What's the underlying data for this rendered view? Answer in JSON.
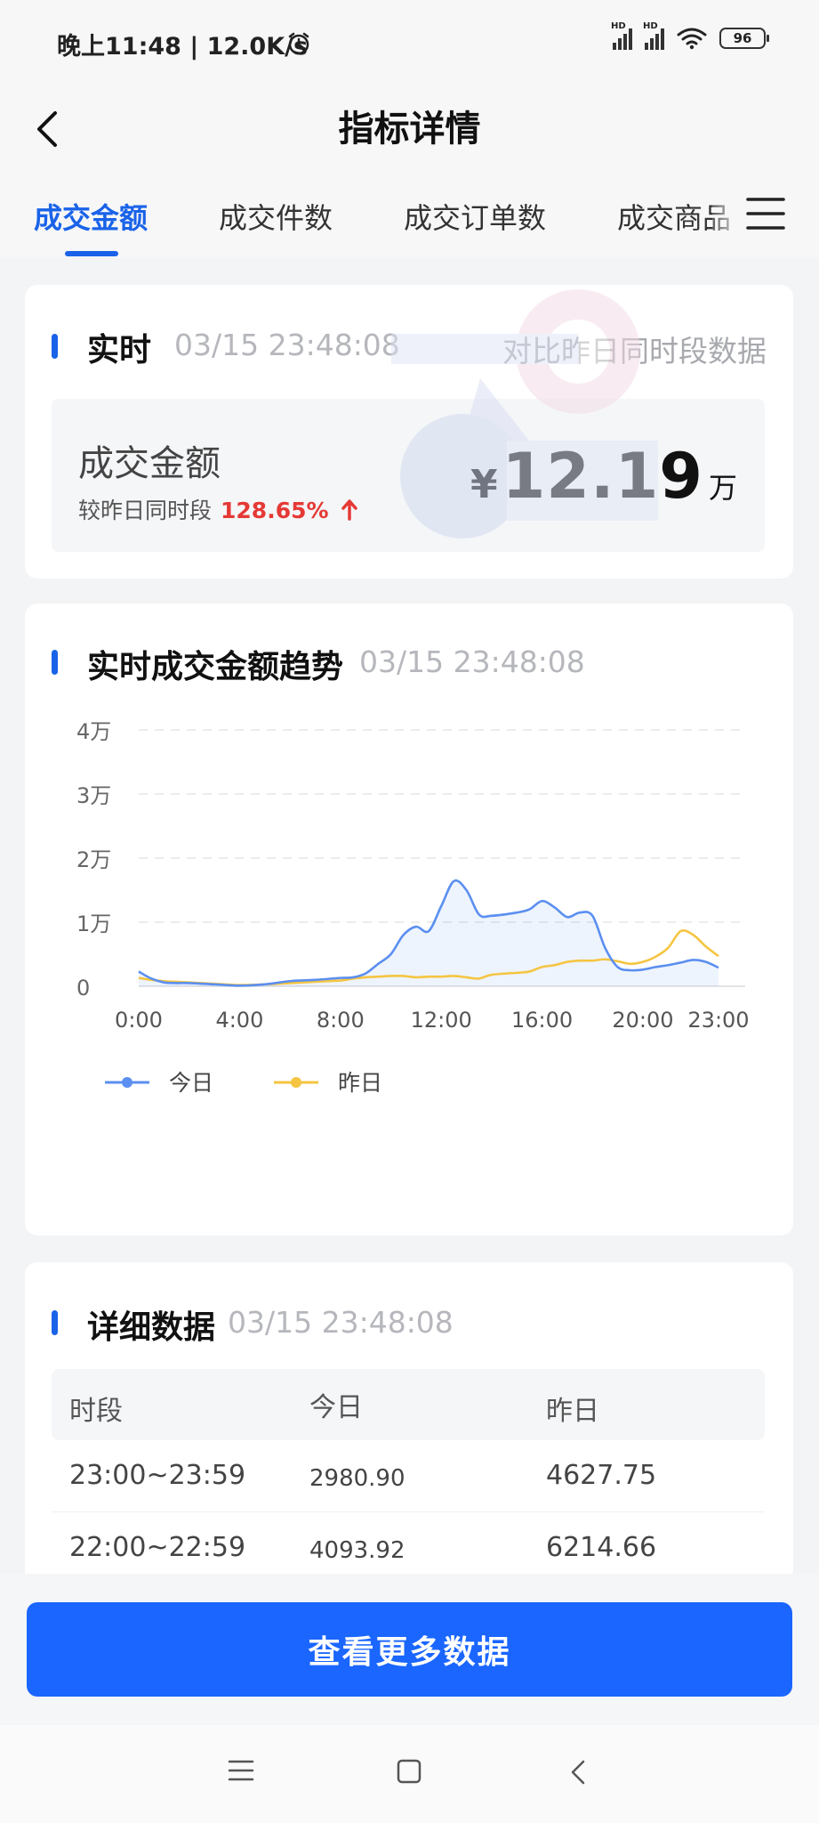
{
  "status_bar": {
    "time": "晚上11:48 | 12.0K/s",
    "signal1": "HD",
    "signal2": "HD",
    "battery": "96",
    "icons": [
      "alarm-icon",
      "signal-icon",
      "signal-icon",
      "wifi-icon",
      "battery-icon"
    ]
  },
  "nav": {
    "title": "指标详情",
    "back_icon": "chevron-left-icon",
    "menu_icon": "menu-icon"
  },
  "tabs": [
    "成交金额",
    "成交件数",
    "成交订单数",
    "成交商品"
  ],
  "realtime": {
    "title": "实时",
    "timestamp": "03/15 23:48:08",
    "compare_link": "对比昨日同时段数据",
    "metric_label": "成交金额",
    "metric_sub": "较昨日同时段",
    "metric_pct": "128.65%",
    "metric_currency": "¥",
    "metric_value": "12.19",
    "metric_unit": "万"
  },
  "trend": {
    "title": "实时成交金额趋势",
    "timestamp": "03/15 23:48:08"
  },
  "chart_data": {
    "type": "area",
    "y_tick_labels": [
      "4万",
      "3万",
      "2万",
      "1万",
      "0"
    ],
    "x_tick_labels": [
      "0:00",
      "4:00",
      "8:00",
      "12:00",
      "16:00",
      "20:00",
      "23:00"
    ],
    "ylim": [
      0,
      40000
    ],
    "grid": true,
    "legend_position": "bottom-left",
    "x": [
      0,
      0.5,
      1,
      1.5,
      2,
      3,
      4,
      5,
      6,
      7,
      8,
      8.5,
      9,
      9.5,
      10,
      10.5,
      11,
      11.5,
      12,
      12.5,
      13,
      13.5,
      14,
      15,
      15.5,
      16,
      16.5,
      17,
      17.5,
      18,
      18.5,
      19,
      19.5,
      20,
      20.5,
      21,
      21.5,
      22,
      22.5,
      23
    ],
    "series": [
      {
        "name": "今日",
        "color": "#5b8ff0",
        "values": [
          2300,
          1200,
          600,
          500,
          500,
          300,
          100,
          300,
          800,
          1000,
          1300,
          1400,
          2000,
          3500,
          5000,
          8000,
          9300,
          8600,
          12500,
          16400,
          15000,
          11200,
          11000,
          11500,
          12000,
          13300,
          12300,
          10800,
          11500,
          11000,
          6000,
          3000,
          2500,
          2600,
          3000,
          3300,
          3700,
          4100,
          3800,
          2900
        ]
      },
      {
        "name": "昨日",
        "color": "#f5c542",
        "values": [
          1300,
          1000,
          800,
          700,
          600,
          400,
          200,
          300,
          500,
          700,
          900,
          1200,
          1400,
          1500,
          1600,
          1600,
          1400,
          1500,
          1500,
          1600,
          1400,
          1200,
          1800,
          2100,
          2300,
          3000,
          3300,
          3800,
          4000,
          4000,
          4200,
          3900,
          3500,
          3800,
          4600,
          6000,
          8600,
          8000,
          6200,
          4700
        ]
      }
    ]
  },
  "detail": {
    "title": "详细数据",
    "timestamp": "03/15 23:48:08",
    "headers": [
      "时段",
      "今日",
      "昨日"
    ],
    "rows": [
      {
        "period": "23:00~23:59",
        "today": "2980.90",
        "yesterday": "4627.75"
      },
      {
        "period": "22:00~22:59",
        "today": "4093.92",
        "yesterday": "6214.66"
      }
    ]
  },
  "more_button": "查看更多数据",
  "system_nav": [
    "menu-icon",
    "home-icon",
    "back-icon"
  ]
}
